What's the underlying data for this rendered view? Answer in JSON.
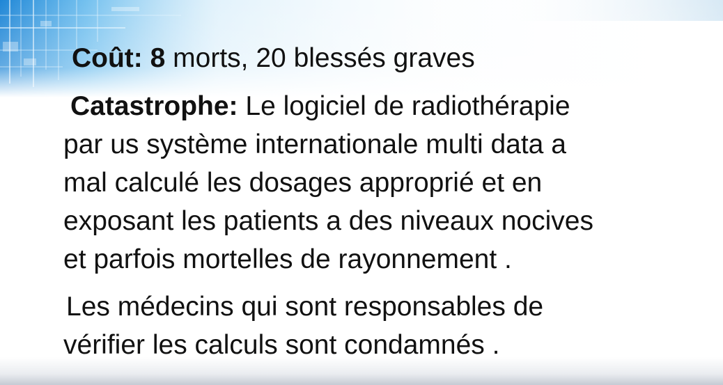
{
  "slide": {
    "cout": {
      "label": "Coût:",
      "number": "8",
      "rest": " morts, 20 blessés graves"
    },
    "catastrophe": {
      "label": "Catastrophe:",
      "line1_rest": " Le logiciel de radiothérapie",
      "line2": "par us système internationale multi data a",
      "line3": "mal calculé les dosages approprié et en",
      "line4": "exposant les patients a des niveaux nocives",
      "line5": "et parfois mortelles de rayonnement ."
    },
    "medecins": {
      "line1": "Les médecins qui sont responsables de",
      "line2": "vérifier les calculs sont condamnés ."
    }
  },
  "theme": {
    "banner_primary": "#2f9be0",
    "banner_light": "#bfe3f7",
    "text_color": "#111111"
  }
}
